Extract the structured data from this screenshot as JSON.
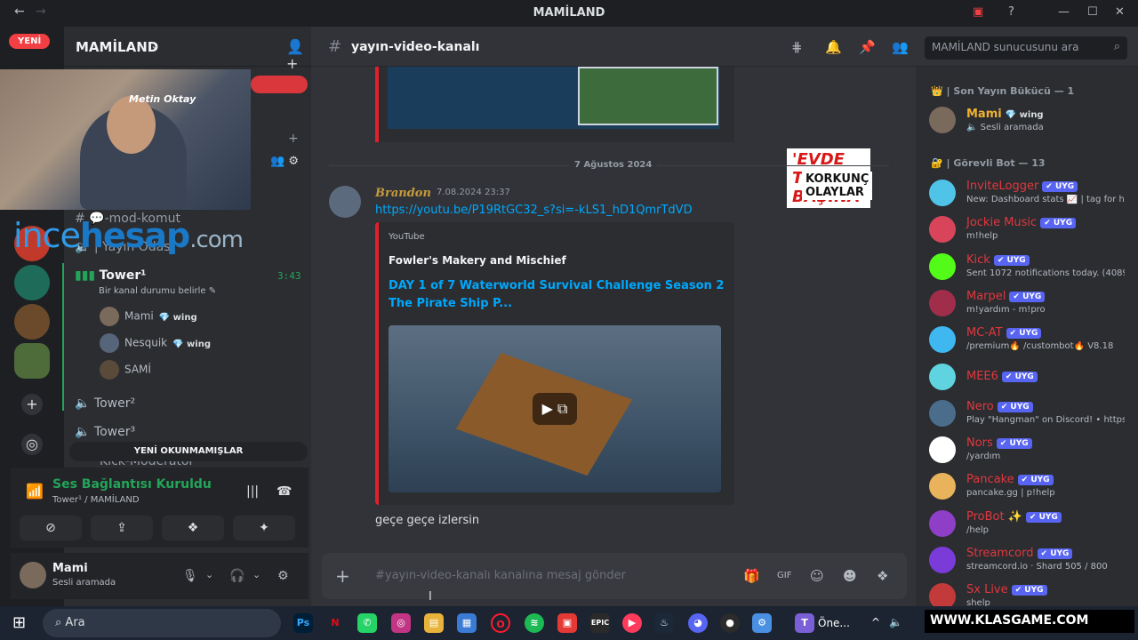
{
  "app": {
    "title": "MAMİLAND"
  },
  "guilds": {
    "new_badge": "YENİ"
  },
  "sidebar": {
    "server_name": "MAMİLAND",
    "webcam_label": "Metin Oktay",
    "watermark": {
      "a": "ince",
      "b": "hesap",
      "c": ".com"
    },
    "channels": {
      "mod_komut": "💬-mod-komut",
      "yayin_odasi": "| Yayın Odası",
      "tower1": "Tower¹",
      "tower1_timer": "3:43",
      "tower1_status": "Bir kanal durumu belirle",
      "tower2": "Tower²",
      "tower3": "Tower³",
      "kick_moderator": "Kick-Moderator"
    },
    "voice_members": [
      {
        "name": "Mami",
        "tag": "💎 wing"
      },
      {
        "name": "Nesquik",
        "tag": "💎 wing"
      },
      {
        "name": "SAMİ",
        "tag": ""
      }
    ],
    "unread_pill": "YENİ OKUNMAMIŞLAR",
    "voice_connection": {
      "status": "Ses Bağlantısı Kuruldu",
      "subtitle": "Tower¹ / MAMİLAND"
    },
    "user": {
      "name": "Mami",
      "status": "Sesli aramada"
    }
  },
  "chat": {
    "channel_name": "yayın-video-kanalı",
    "search_placeholder": "MAMİLAND sunucusunu ara",
    "prev_thumb": {
      "line1": "'EVDE TEK BAŞINA'",
      "line2": "KORKUNÇ OLAYLAR"
    },
    "date_divider": "7 Ağustos 2024",
    "message": {
      "author": "Brandon",
      "time": "7.08.2024 23:37",
      "link": "https://youtu.be/P19RtGC32_s?si=-kLS1_hD1QmrTdVD",
      "embed": {
        "provider": "YouTube",
        "author": "Fowler's Makery and Mischief",
        "title": "DAY 1 of 7 Waterworld Survival Challenge Season 2 The Pirate Ship P..."
      }
    },
    "followup": "geçe geçe izlersin",
    "composer_placeholder": "#yayın-video-kanalı kanalına mesaj gönder"
  },
  "members": {
    "cat_owner": "👑 | Son Yayın Bükücü — 1",
    "cat_bots": "🔐 | Görevli Bot — 13",
    "owner": {
      "name": "Mami",
      "tag": "💎 wing",
      "activity": "🔈 Sesli aramada"
    },
    "bots": [
      {
        "name": "InviteLogger",
        "activity": "New: Dashboard stats 📈 | tag for he",
        "color": "#4fc3e8"
      },
      {
        "name": "Jockie Music",
        "activity": "m!help",
        "color": "#d8455a"
      },
      {
        "name": "Kick",
        "activity": "Sent 1072 notifications today. (4089",
        "color": "#53fc18"
      },
      {
        "name": "Marpel",
        "activity": "m!yardım - m!pro",
        "color": "#a02e4b"
      },
      {
        "name": "MC-AT",
        "activity": "/premium🔥 /custombot🔥 V8.18",
        "color": "#3fb7f0"
      },
      {
        "name": "MEE6",
        "activity": "",
        "color": "#5fd3e0"
      },
      {
        "name": "Nero",
        "activity": "Play \"Hangman\" on Discord! • https:/",
        "color": "#4a6d8c"
      },
      {
        "name": "Nors",
        "activity": "/yardım",
        "color": "#ffffff"
      },
      {
        "name": "Pancake",
        "activity": "pancake.gg | p!help",
        "color": "#e8b35a"
      },
      {
        "name": "ProBot ✨",
        "activity": "/help",
        "color": "#8e3ec7"
      },
      {
        "name": "Streamcord",
        "activity": "streamcord.io · Shard 505 / 800",
        "color": "#7b3bd8"
      },
      {
        "name": "Sx Live",
        "activity": "shelp",
        "color": "#c23a3a"
      }
    ],
    "bot_badge": "✔ UYG"
  },
  "taskbar": {
    "search": "Ara",
    "app_label": "Öne...",
    "watermark": "WWW.KLASGAME.COM"
  }
}
